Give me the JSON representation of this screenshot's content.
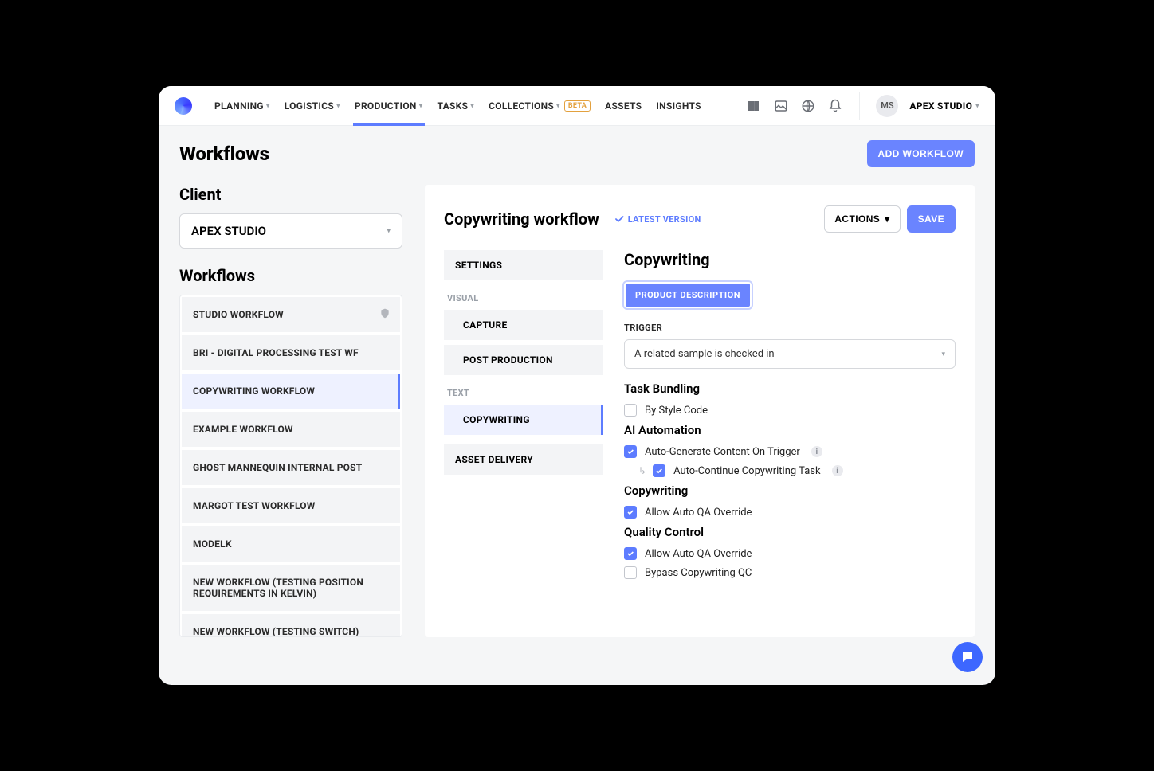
{
  "nav": {
    "planning": "PLANNING",
    "logistics": "LOGISTICS",
    "production": "PRODUCTION",
    "tasks": "TASKS",
    "collections": "COLLECTIONS",
    "beta": "BETA",
    "assets": "ASSETS",
    "insights": "INSIGHTS"
  },
  "user": {
    "initials": "MS",
    "org": "APEX STUDIO"
  },
  "page": {
    "title": "Workflows",
    "add_button": "ADD WORKFLOW"
  },
  "left": {
    "client_label": "Client",
    "client_value": "APEX STUDIO",
    "workflows_label": "Workflows",
    "items": [
      "STUDIO WORKFLOW",
      "BRI - DIGITAL PROCESSING TEST WF",
      "COPYWRITING WORKFLOW",
      "EXAMPLE WORKFLOW",
      "GHOST MANNEQUIN INTERNAL POST",
      "MARGOT TEST WORKFLOW",
      "MODELK",
      "NEW WORKFLOW (TESTING POSITION REQUIREMENTS IN KELVIN)",
      "NEW WORKFLOW (TESTING SWITCH)"
    ]
  },
  "panel": {
    "title": "Copywriting workflow",
    "latest": "LATEST VERSION",
    "actions": "ACTIONS",
    "save": "SAVE",
    "steps": {
      "settings": "SETTINGS",
      "visual": "VISUAL",
      "capture": "CAPTURE",
      "post": "POST PRODUCTION",
      "text": "TEXT",
      "copywriting": "COPYWRITING",
      "asset": "ASSET DELIVERY"
    }
  },
  "form": {
    "heading": "Copywriting",
    "pill": "PRODUCT DESCRIPTION",
    "trigger_label": "TRIGGER",
    "trigger_value": "A related sample is checked in",
    "bundling_h": "Task Bundling",
    "by_style": "By Style Code",
    "ai_h": "AI Automation",
    "auto_gen": "Auto-Generate Content On Trigger",
    "auto_cont": "Auto-Continue Copywriting Task",
    "copy_h": "Copywriting",
    "allow_auto": "Allow Auto QA Override",
    "qc_h": "Quality Control",
    "allow_auto_qc": "Allow Auto QA Override",
    "bypass": "Bypass Copywriting QC"
  }
}
